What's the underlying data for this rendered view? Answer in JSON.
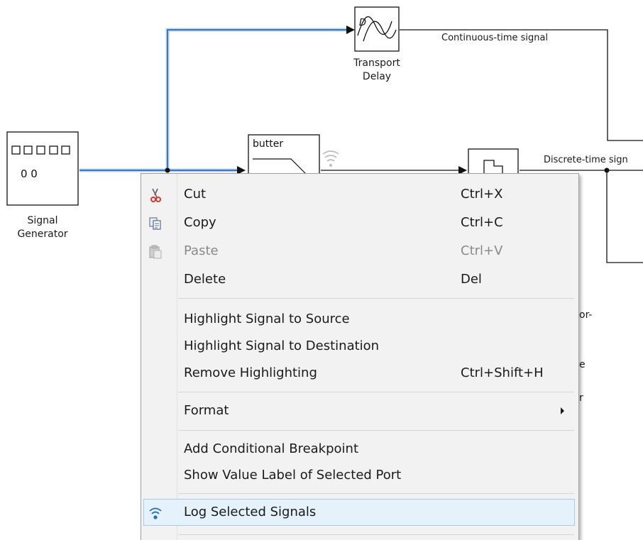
{
  "diagram": {
    "blocks": {
      "signal_generator": {
        "label_line1": "Signal",
        "label_line2": "Generator",
        "icon_glyph": "0 0"
      },
      "transport_delay": {
        "label_line1": "Transport",
        "label_line2": "Delay"
      },
      "butter_filter": {
        "text": "butter"
      }
    },
    "signals": {
      "continuous": "Continuous-time signal",
      "discrete": "Discrete-time sign"
    },
    "obscured_fragments": [
      "or-",
      "e",
      "r"
    ]
  },
  "context_menu": {
    "items": [
      {
        "label": "Cut",
        "shortcut": "Ctrl+X",
        "icon": "scissors-icon",
        "enabled": true
      },
      {
        "label": "Copy",
        "shortcut": "Ctrl+C",
        "icon": "copy-icon",
        "enabled": true
      },
      {
        "label": "Paste",
        "shortcut": "Ctrl+V",
        "icon": "paste-icon",
        "enabled": false
      },
      {
        "label": "Delete",
        "shortcut": "Del",
        "icon": "",
        "enabled": true
      },
      {
        "label": "Highlight Signal to Source",
        "shortcut": "",
        "enabled": true
      },
      {
        "label": "Highlight Signal to Destination",
        "shortcut": "",
        "enabled": true
      },
      {
        "label": "Remove Highlighting",
        "shortcut": "Ctrl+Shift+H",
        "enabled": true
      },
      {
        "label": "Format",
        "shortcut": "",
        "submenu": true,
        "enabled": true
      },
      {
        "label": "Add Conditional Breakpoint",
        "shortcut": "",
        "enabled": true
      },
      {
        "label": "Show Value Label of Selected Port",
        "shortcut": "",
        "enabled": true
      },
      {
        "label": "Log Selected Signals",
        "shortcut": "",
        "icon": "log-signal-icon",
        "enabled": true,
        "hovered": true
      }
    ]
  },
  "colors": {
    "selection_blue": "#3a78c3",
    "menu_bg": "#f2f2f2",
    "hover_bg": "#e5f1fb",
    "disabled_text": "#8a8a8a"
  }
}
